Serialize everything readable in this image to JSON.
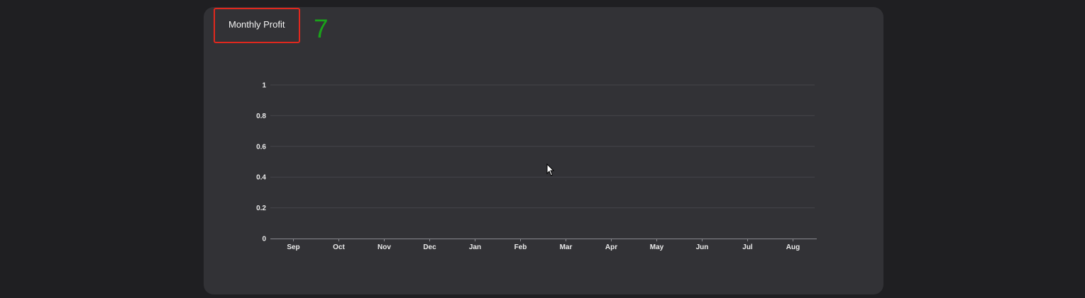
{
  "card": {
    "title": "Monthly Profit",
    "annotation": "7"
  },
  "chart_data": {
    "type": "line",
    "title": "Monthly Profit",
    "xlabel": "",
    "ylabel": "",
    "categories": [
      "Sep",
      "Oct",
      "Nov",
      "Dec",
      "Jan",
      "Feb",
      "Mar",
      "Apr",
      "May",
      "Jun",
      "Jul",
      "Aug"
    ],
    "yticks": [
      "0",
      "0.2",
      "0.4",
      "0.6",
      "0.8",
      "1"
    ],
    "ylim": [
      0,
      1
    ],
    "series": [],
    "grid": true,
    "colors": {
      "grid": "#45454a",
      "axis": "#8a8a8f",
      "tick_label": "#eaeaea"
    }
  }
}
